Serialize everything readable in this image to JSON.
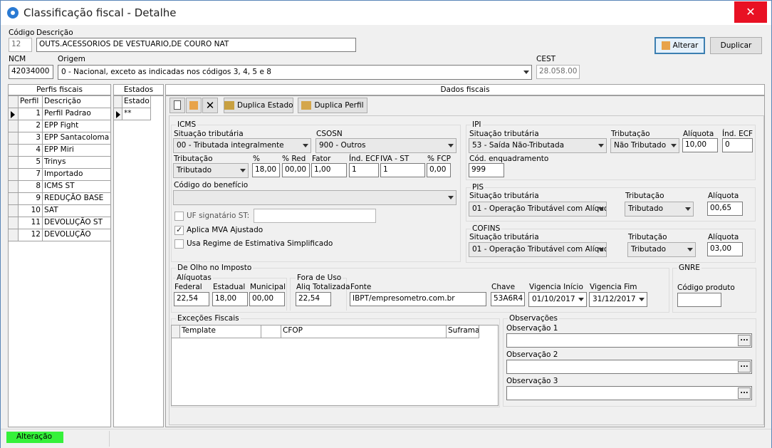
{
  "window": {
    "title": "Classificação fiscal - Detalhe",
    "close": "✕"
  },
  "header": {
    "codigo_label": "Código",
    "codigo_value": "12",
    "descricao_label": "Descrição",
    "descricao_value": "OUTS.ACESSORIOS DE VESTUARIO,DE COURO NAT",
    "ncm_label": "NCM",
    "ncm_value": "42034000",
    "origem_label": "Origem",
    "origem_value": "0 - Nacional, exceto as indicadas nos códigos 3, 4, 5 e 8",
    "cest_label": "CEST",
    "cest_value": "28.058.00",
    "alterar_label": "Alterar",
    "duplicar_label": "Duplicar"
  },
  "perfis": {
    "title": "Perfis fiscais",
    "col_perfil": "Perfil",
    "col_descricao": "Descrição",
    "rows": [
      {
        "n": "1",
        "d": "Perfil Padrao"
      },
      {
        "n": "2",
        "d": "EPP Fight"
      },
      {
        "n": "3",
        "d": "EPP Santacoloma"
      },
      {
        "n": "4",
        "d": "EPP Miri"
      },
      {
        "n": "5",
        "d": "Trinys"
      },
      {
        "n": "7",
        "d": "Importado"
      },
      {
        "n": "8",
        "d": "ICMS ST"
      },
      {
        "n": "9",
        "d": "REDUÇÃO BASE"
      },
      {
        "n": "10",
        "d": "SAT"
      },
      {
        "n": "11",
        "d": "DEVOLUÇÃO ST"
      },
      {
        "n": "12",
        "d": "DEVOLUÇÃO"
      }
    ]
  },
  "estados": {
    "title": "Estados",
    "col": "Estado",
    "rows": [
      "**"
    ]
  },
  "dados": {
    "title": "Dados fiscais",
    "duplica_estado": "Duplica Estado",
    "duplica_perfil": "Duplica Perfil",
    "icms": {
      "title": "ICMS",
      "sit_label": "Situação tributária",
      "sit_value": "00 - Tributada integralmente",
      "csosn_label": "CSOSN",
      "csosn_value": "900 - Outros",
      "trib_label": "Tributação",
      "trib_value": "Tributado",
      "pct_label": "%",
      "pct_value": "18,00",
      "red_label": "% Red",
      "red_value": "00,00",
      "fator_label": "Fator",
      "fator_value": "1,00",
      "ecf_label": "Índ. ECF",
      "ecf_value": "1",
      "iva_label": "IVA - ST",
      "iva_value": "1",
      "fcp_label": "% FCP",
      "fcp_value": "0,00",
      "beneficio_label": "Código do benefício",
      "beneficio_value": "",
      "uf_label": "UF signatário ST:",
      "mva_label": "Aplica MVA Ajustado",
      "regime_label": "Usa Regime de Estimativa Simplificado"
    },
    "ipi": {
      "title": "IPI",
      "sit_label": "Situação tributária",
      "sit_value": "53 - Saída Não-Tributada",
      "trib_label": "Tributação",
      "trib_value": "Não Tributado",
      "aliq_label": "Alíquota",
      "aliq_value": "10,00",
      "ecf_label": "Índ. ECF",
      "ecf_value": "0",
      "enq_label": "Cód. enquadramento",
      "enq_value": "999"
    },
    "pis": {
      "title": "PIS",
      "sit_label": "Situação tributária",
      "sit_value": "01 - Operação Tributável com Alíquo",
      "trib_label": "Tributação",
      "trib_value": "Tributado",
      "aliq_label": "Alíquota",
      "aliq_value": "00,65"
    },
    "cofins": {
      "title": "COFINS",
      "sit_label": "Situação tributária",
      "sit_value": "01 - Operação Tributável com Alíquo",
      "trib_label": "Tributação",
      "trib_value": "Tributado",
      "aliq_label": "Alíquota",
      "aliq_value": "03,00"
    },
    "olho": {
      "title": "De Olho no Imposto",
      "aliq_title": "Alíquotas",
      "federal_label": "Federal",
      "federal_value": "22,54",
      "estadual_label": "Estadual",
      "estadual_value": "18,00",
      "municipal_label": "Municipal",
      "municipal_value": "00,00",
      "fora_title": "Fora de Uso",
      "aliq_tot_label": "Aliq Totalizada",
      "aliq_tot_value": "22,54",
      "fonte_label": "Fonte",
      "fonte_value": "IBPT/empresometro.com.br",
      "chave_label": "Chave",
      "chave_value": "53A6R4",
      "vig_ini_label": "Vigencia Início",
      "vig_ini_value": "01/10/2017",
      "vig_fim_label": "Vigencia Fim",
      "vig_fim_value": "31/12/2017"
    },
    "gnre": {
      "title": "GNRE",
      "cod_label": "Código produto",
      "cod_value": ""
    },
    "excecoes": {
      "title": "Exceções Fiscais",
      "col_template": "Template",
      "col_cfop": "CFOP",
      "col_suframa": "Suframa"
    },
    "obs": {
      "title": "Observações",
      "o1": "Observação 1",
      "o2": "Observação 2",
      "o3": "Observação 3",
      "dots": "..."
    }
  },
  "status": {
    "mode": "Alteração"
  }
}
